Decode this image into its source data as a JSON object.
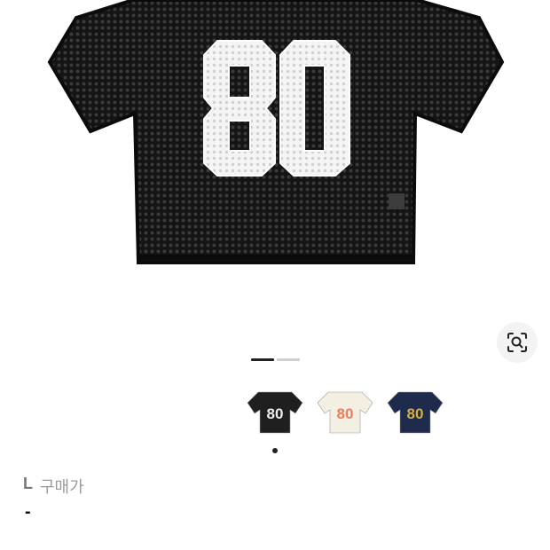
{
  "product": {
    "jersey_number": "80",
    "jersey_color": "#1a1a1a",
    "number_color": "#f2f2f2"
  },
  "gallery": {
    "pages": 2,
    "current_page": 1
  },
  "lens_icon": "camera-lens-search-icon",
  "swatches": [
    {
      "number": "80",
      "body": "#1f1f1f",
      "digits": "#eeeeee",
      "name": "black"
    },
    {
      "number": "80",
      "body": "#f3efe3",
      "digits": "#f07a5a",
      "name": "cream"
    },
    {
      "number": "80",
      "body": "#1e2b4d",
      "digits": "#d6b042",
      "name": "navy"
    }
  ],
  "selected_swatch": 0,
  "size": {
    "label": "L",
    "text": "구매가"
  },
  "price": {
    "value": "-"
  }
}
